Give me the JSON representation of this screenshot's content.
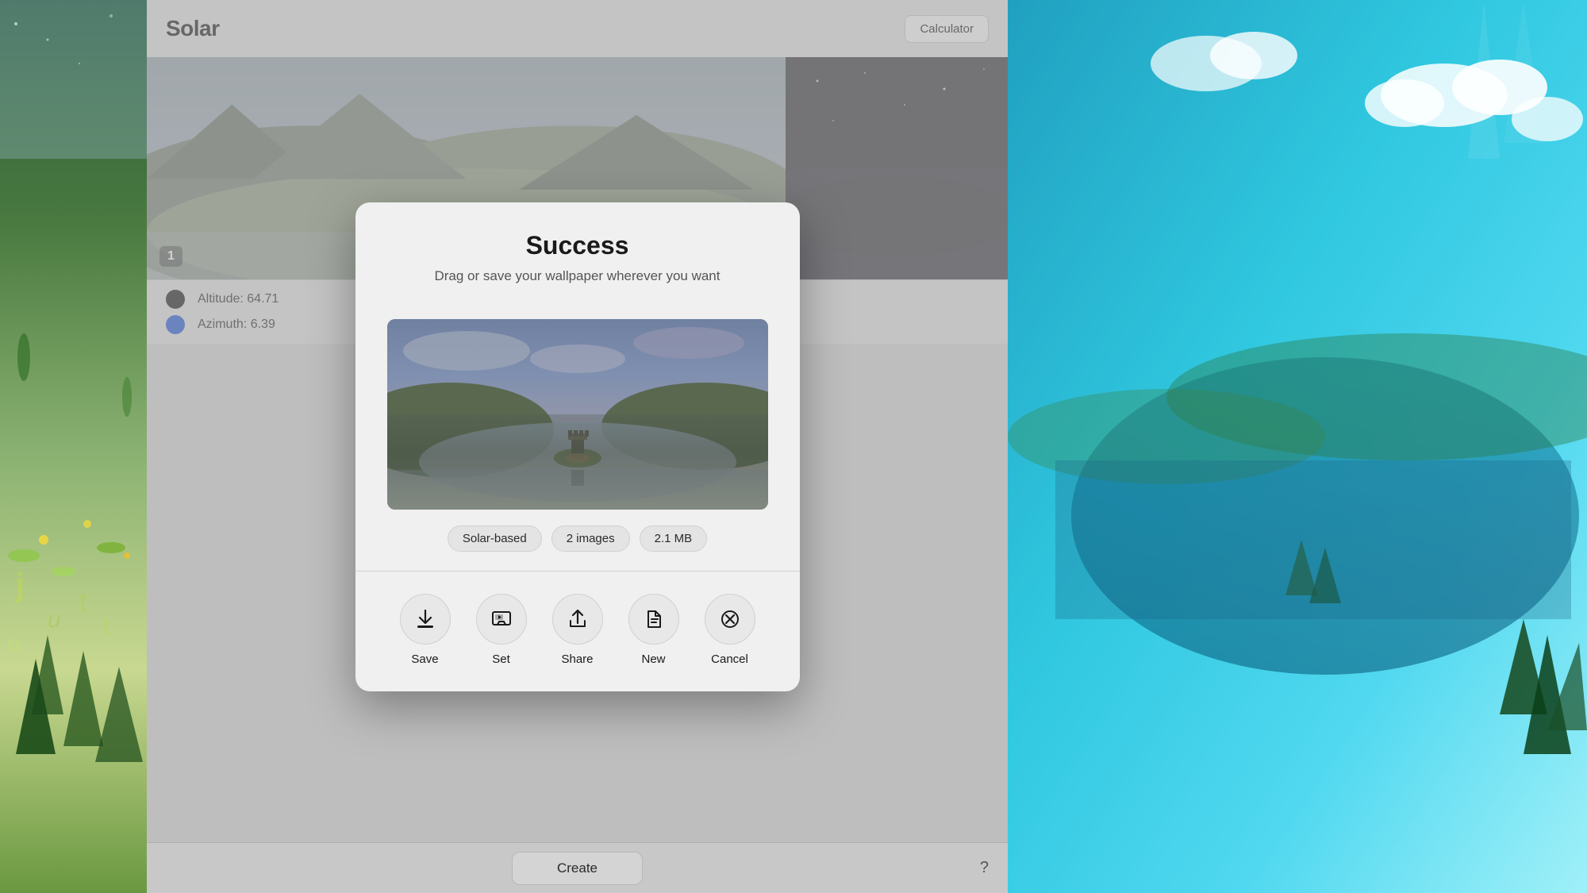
{
  "app": {
    "title": "Solar",
    "calculator_button": "Calculator"
  },
  "data_panel": {
    "altitude_label": "Altitude:",
    "altitude_value": "64.71",
    "azimuth_label": "Azimuth:",
    "azimuth_value": "6.39"
  },
  "modal": {
    "title": "Success",
    "subtitle": "Drag or save your wallpaper wherever you want",
    "tags": {
      "type": "Solar-based",
      "count": "2 images",
      "size": "2.1 MB"
    },
    "actions": {
      "save": "Save",
      "set": "Set",
      "share": "Share",
      "new": "New",
      "cancel": "Cancel"
    }
  },
  "bottom": {
    "create": "Create",
    "help": "?"
  },
  "badge": {
    "number": "1"
  }
}
